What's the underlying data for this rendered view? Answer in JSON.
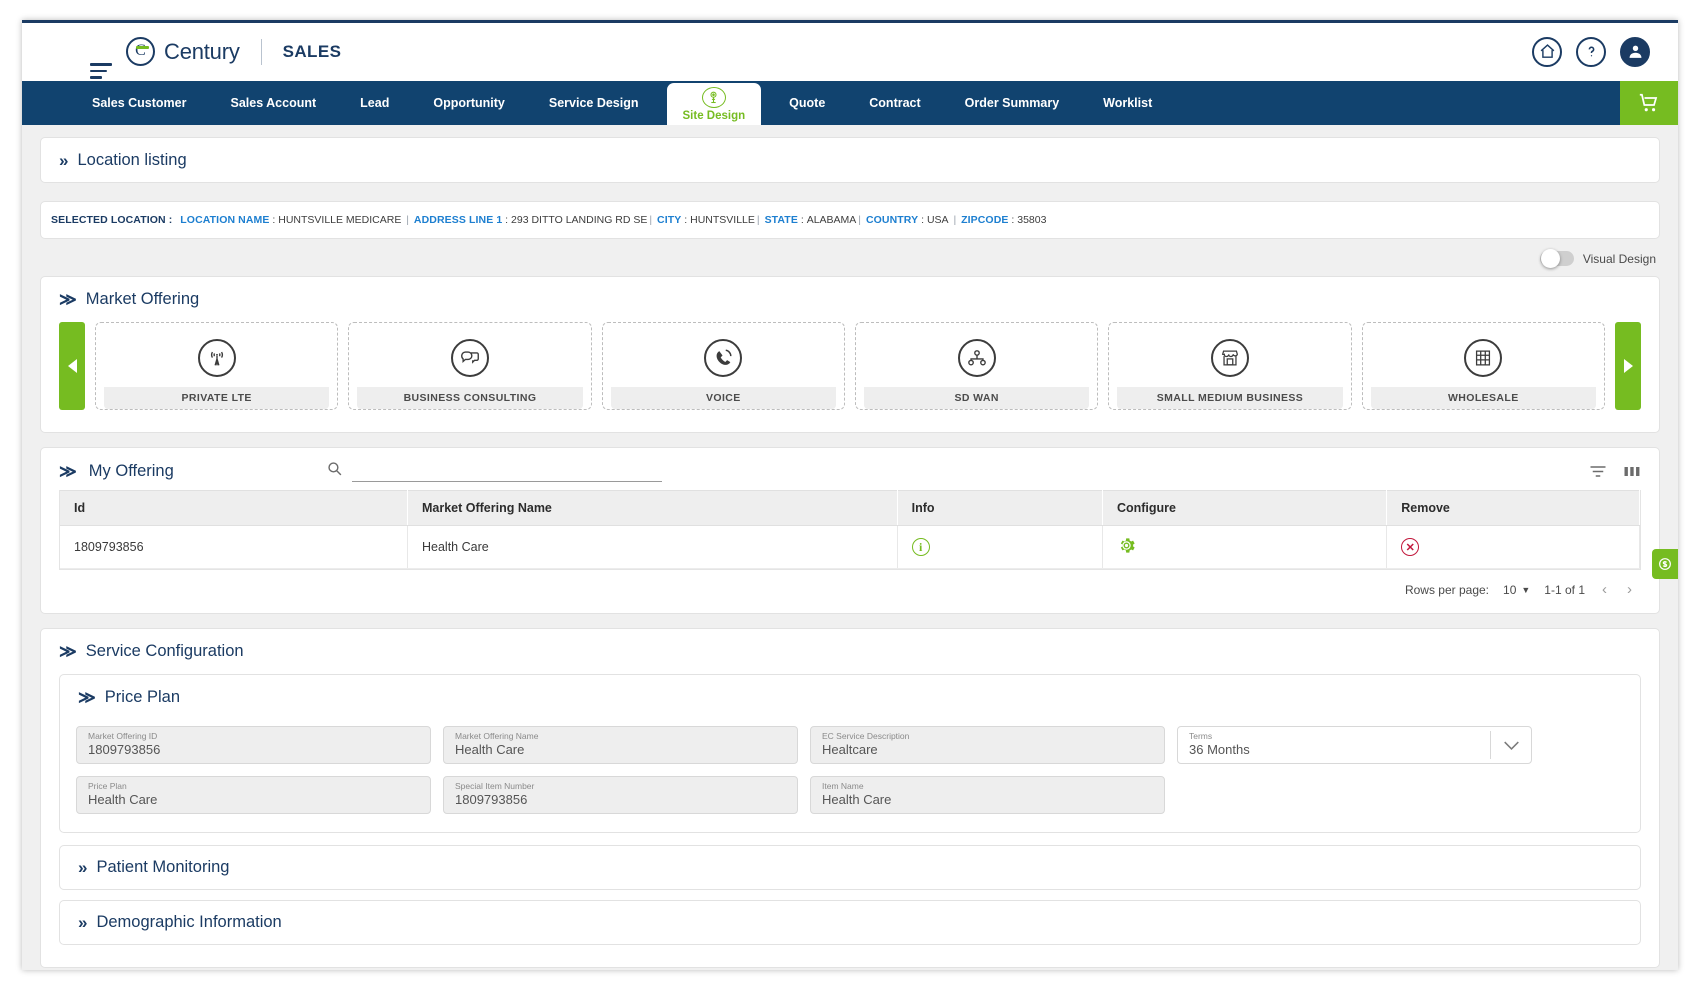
{
  "header": {
    "menu_icon": "hamburger-icon",
    "brand": "Century",
    "brand_sub": "SALES",
    "home_icon": "home-icon",
    "help_icon": "help-icon",
    "user_icon": "user-avatar-icon"
  },
  "nav": {
    "tabs": [
      {
        "label": "Sales Customer",
        "active": false
      },
      {
        "label": "Sales Account",
        "active": false
      },
      {
        "label": "Lead",
        "active": false
      },
      {
        "label": "Opportunity",
        "active": false
      },
      {
        "label": "Service Design",
        "active": false
      },
      {
        "label": "Site Design",
        "active": true
      },
      {
        "label": "Quote",
        "active": false
      },
      {
        "label": "Contract",
        "active": false
      },
      {
        "label": "Order Summary",
        "active": false
      },
      {
        "label": "Worklist",
        "active": false
      }
    ],
    "cart_icon": "shopping-cart-icon"
  },
  "location_listing": {
    "title": "Location listing",
    "chevron": "chevron-right-double"
  },
  "selected_location": {
    "prefix": "SELECTED LOCATION :",
    "fields": [
      {
        "key": "LOCATION NAME",
        "value": "HUNTSVILLE MEDICARE"
      },
      {
        "key": "ADDRESS LINE 1",
        "value": "293 DITTO LANDING RD SE"
      },
      {
        "key": "CITY",
        "value": "HUNTSVILLE"
      },
      {
        "key": "STATE",
        "value": "ALABAMA"
      },
      {
        "key": "COUNTRY",
        "value": "USA"
      },
      {
        "key": "ZIPCODE",
        "value": "35803"
      }
    ]
  },
  "visual_design_toggle": {
    "label": "Visual Design",
    "on": false
  },
  "market_offering": {
    "title": "Market Offering",
    "chevron": "chevron-down-double",
    "prev_label": "previous",
    "next_label": "next",
    "cards": [
      {
        "label": "PRIVATE LTE",
        "icon": "cell-tower-icon"
      },
      {
        "label": "BUSINESS CONSULTING",
        "icon": "chat-bubbles-icon"
      },
      {
        "label": "VOICE",
        "icon": "phone-icon"
      },
      {
        "label": "SD WAN",
        "icon": "network-nodes-icon"
      },
      {
        "label": "SMALL MEDIUM BUSINESS",
        "icon": "storefront-icon"
      },
      {
        "label": "WHOLESALE",
        "icon": "warehouse-icon"
      }
    ]
  },
  "my_offering": {
    "title": "My Offering",
    "chevron": "chevron-down-double",
    "search_value": "",
    "search_placeholder": "",
    "filter_icon": "filter-icon",
    "columns_icon": "columns-icon",
    "columns": [
      "Id",
      "Market Offering Name",
      "Info",
      "Configure",
      "Remove"
    ],
    "rows": [
      {
        "id": "1809793856",
        "name": "Health Care",
        "info_icon": "info-icon",
        "configure_icon": "gear-icon",
        "remove_icon": "remove-circle-icon"
      }
    ],
    "paging": {
      "rows_per_page_label": "Rows per page:",
      "rows_per_page_value": "10",
      "range": "1-1 of 1",
      "prev_icon": "chevron-left-icon",
      "next_icon": "chevron-right-icon"
    }
  },
  "service_configuration": {
    "title": "Service Configuration",
    "chevron": "chevron-down-double",
    "price_plan": {
      "title": "Price Plan",
      "chevron": "chevron-down-double",
      "fields": [
        {
          "label": "Market Offering ID",
          "value": "1809793856",
          "type": "text"
        },
        {
          "label": "Market Offering Name",
          "value": "Health Care",
          "type": "text"
        },
        {
          "label": "EC Service Description",
          "value": "Healtcare",
          "type": "text"
        },
        {
          "label": "Terms",
          "value": "36 Months",
          "type": "select"
        },
        {
          "label": "Price Plan",
          "value": "Health Care",
          "type": "text"
        },
        {
          "label": "Special Item Number",
          "value": "1809793856",
          "type": "text"
        },
        {
          "label": "Item Name",
          "value": "Health Care",
          "type": "text"
        }
      ]
    },
    "sections": [
      {
        "title": "Patient Monitoring",
        "chevron": "chevron-right-double"
      },
      {
        "title": "Demographic Information",
        "chevron": "chevron-right-double"
      }
    ]
  },
  "side_tab": {
    "icon": "currency-tag-icon"
  },
  "colors": {
    "brand_navy": "#11436f",
    "brand_green": "#76bc21",
    "link_blue": "#1d7fd0",
    "danger_red": "#c2183c",
    "page_bg": "#f0f0f0"
  }
}
